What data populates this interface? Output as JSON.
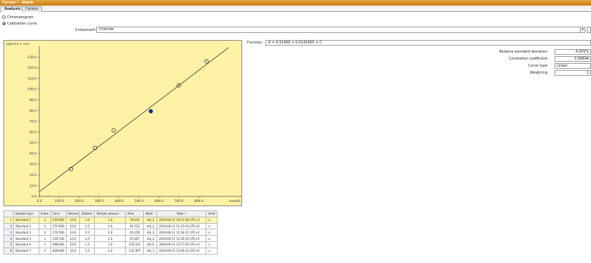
{
  "window": {
    "title": "Curves I - Blank"
  },
  "tabs": [
    {
      "label": "Analysis"
    },
    {
      "label": "Cations"
    }
  ],
  "options": {
    "chromatogram": "Chromatogram",
    "calibration": "Calibration curve"
  },
  "component": {
    "label": "Component",
    "value": "Chloride",
    "arrow": "▾"
  },
  "function": {
    "label": "Function:",
    "value": "A = 4.31409 + 0.0141655 × C"
  },
  "stats": [
    {
      "label": "Relative standard deviation",
      "value": "4.501%"
    },
    {
      "label": "Correlation coefficient",
      "value": "0.99694"
    },
    {
      "label": "Curve type",
      "value": "Linear"
    },
    {
      "label": "Weighting",
      "value": "1"
    }
  ],
  "colors": {
    "plot_bg": "#fdf2a6",
    "accent": "#d48c1e",
    "selected_point": "#1a2a8a"
  },
  "chart_data": {
    "type": "scatter",
    "ylabel": "(µS/cm) × min",
    "xlabel": "mmol/L",
    "xlim": [
      0,
      950
    ],
    "ylim": [
      0,
      140
    ],
    "yticks": [
      "0.0",
      "10.0",
      "20.0",
      "30.0",
      "40.0",
      "50.0",
      "60.0",
      "70.0",
      "80.0",
      "90.0",
      "100.0",
      "110.0",
      "120.0",
      "130.0"
    ],
    "xticks": [
      "0.0",
      "100.0",
      "200.0",
      "300.0",
      "400.0",
      "500.0",
      "600.0",
      "700.0",
      "800.0"
    ],
    "ytick_values": [
      0,
      10,
      20,
      30,
      40,
      50,
      60,
      70,
      80,
      90,
      100,
      110,
      120,
      130
    ],
    "xtick_values": [
      0,
      100,
      200,
      300,
      400,
      500,
      600,
      700,
      800
    ],
    "line": {
      "x": [
        0,
        950
      ],
      "y": [
        4.3,
        138.9
      ]
    },
    "points": [
      {
        "x": 159.7,
        "y": 25.5,
        "selected": false
      },
      {
        "x": 279.5,
        "y": 45.2,
        "selected": false
      },
      {
        "x": 372.6,
        "y": 61.5,
        "selected": false
      },
      {
        "x": 559.0,
        "y": 79.4,
        "selected": true
      },
      {
        "x": 698.9,
        "y": 103.5,
        "selected": false
      },
      {
        "x": 838.6,
        "y": 125.9,
        "selected": false
      }
    ]
  },
  "table": {
    "headers": [
      "",
      "Sample type",
      "Index",
      "Conc.",
      "Volume",
      "Dilution",
      "Sample amount",
      "Area",
      "Ident",
      "Date ↑",
      "Used"
    ],
    "rows": [
      {
        "n": "1",
        "type": "Standard 1",
        "index": "1",
        "conc": "559.000",
        "volume": "10.0",
        "dilution": "1.0",
        "amount": "1.0",
        "area": "79.435",
        "ident": "std_1",
        "date": "2018-06-11 10:51:38 UTC+0",
        "sel": true
      },
      {
        "n": "2",
        "type": "Standard 2",
        "index": "1",
        "conc": "372.600",
        "volume": "10.0",
        "dilution": "1.0",
        "amount": "1.0",
        "area": "61.522",
        "ident": "std_2",
        "date": "2018-06-11 11:23:03 UTC+0",
        "sel": false
      },
      {
        "n": "3",
        "type": "Standard 3",
        "index": "1",
        "conc": "279.500",
        "volume": "10.0",
        "dilution": "1.0",
        "amount": "1.0",
        "area": "45.228",
        "ident": "std_3",
        "date": "2018-06-11 11:54:37 UTC+0",
        "sel": false
      },
      {
        "n": "4",
        "type": "Standard 4",
        "index": "1",
        "conc": "159.700",
        "volume": "10.0",
        "dilution": "1.0",
        "amount": "1.0",
        "area": "25.497",
        "ident": "std_4",
        "date": "2018-06-11 12:26:10 UTC+0",
        "sel": false
      },
      {
        "n": "5",
        "type": "Standard 6",
        "index": "1",
        "conc": "698.900",
        "volume": "10.0",
        "dilution": "1.0",
        "amount": "1.0",
        "area": "103.541",
        "ident": "std_6",
        "date": "2018-06-11 12:57:42 UTC+0",
        "sel": false
      },
      {
        "n": "6",
        "type": "Standard 7",
        "index": "1",
        "conc": "838.600",
        "volume": "10.0",
        "dilution": "1.0",
        "amount": "1.0",
        "area": "125.907",
        "ident": "std_7",
        "date": "2018-06-11 13:29:15 UTC+0",
        "sel": false
      }
    ]
  }
}
